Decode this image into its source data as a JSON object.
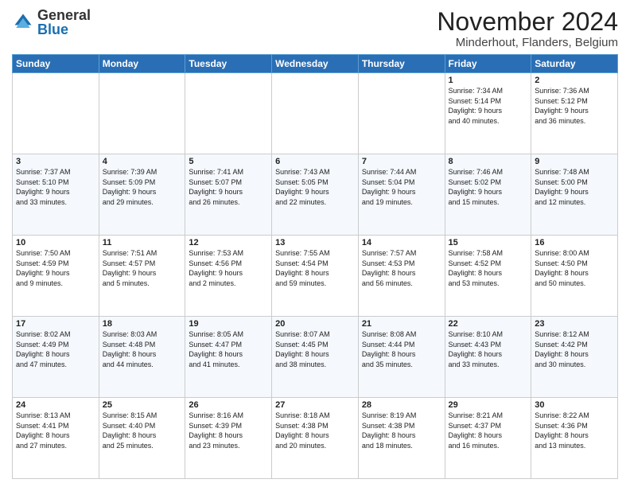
{
  "logo": {
    "general": "General",
    "blue": "Blue"
  },
  "header": {
    "month": "November 2024",
    "location": "Minderhout, Flanders, Belgium"
  },
  "weekdays": [
    "Sunday",
    "Monday",
    "Tuesday",
    "Wednesday",
    "Thursday",
    "Friday",
    "Saturday"
  ],
  "weeks": [
    [
      {
        "day": "",
        "info": ""
      },
      {
        "day": "",
        "info": ""
      },
      {
        "day": "",
        "info": ""
      },
      {
        "day": "",
        "info": ""
      },
      {
        "day": "",
        "info": ""
      },
      {
        "day": "1",
        "info": "Sunrise: 7:34 AM\nSunset: 5:14 PM\nDaylight: 9 hours\nand 40 minutes."
      },
      {
        "day": "2",
        "info": "Sunrise: 7:36 AM\nSunset: 5:12 PM\nDaylight: 9 hours\nand 36 minutes."
      }
    ],
    [
      {
        "day": "3",
        "info": "Sunrise: 7:37 AM\nSunset: 5:10 PM\nDaylight: 9 hours\nand 33 minutes."
      },
      {
        "day": "4",
        "info": "Sunrise: 7:39 AM\nSunset: 5:09 PM\nDaylight: 9 hours\nand 29 minutes."
      },
      {
        "day": "5",
        "info": "Sunrise: 7:41 AM\nSunset: 5:07 PM\nDaylight: 9 hours\nand 26 minutes."
      },
      {
        "day": "6",
        "info": "Sunrise: 7:43 AM\nSunset: 5:05 PM\nDaylight: 9 hours\nand 22 minutes."
      },
      {
        "day": "7",
        "info": "Sunrise: 7:44 AM\nSunset: 5:04 PM\nDaylight: 9 hours\nand 19 minutes."
      },
      {
        "day": "8",
        "info": "Sunrise: 7:46 AM\nSunset: 5:02 PM\nDaylight: 9 hours\nand 15 minutes."
      },
      {
        "day": "9",
        "info": "Sunrise: 7:48 AM\nSunset: 5:00 PM\nDaylight: 9 hours\nand 12 minutes."
      }
    ],
    [
      {
        "day": "10",
        "info": "Sunrise: 7:50 AM\nSunset: 4:59 PM\nDaylight: 9 hours\nand 9 minutes."
      },
      {
        "day": "11",
        "info": "Sunrise: 7:51 AM\nSunset: 4:57 PM\nDaylight: 9 hours\nand 5 minutes."
      },
      {
        "day": "12",
        "info": "Sunrise: 7:53 AM\nSunset: 4:56 PM\nDaylight: 9 hours\nand 2 minutes."
      },
      {
        "day": "13",
        "info": "Sunrise: 7:55 AM\nSunset: 4:54 PM\nDaylight: 8 hours\nand 59 minutes."
      },
      {
        "day": "14",
        "info": "Sunrise: 7:57 AM\nSunset: 4:53 PM\nDaylight: 8 hours\nand 56 minutes."
      },
      {
        "day": "15",
        "info": "Sunrise: 7:58 AM\nSunset: 4:52 PM\nDaylight: 8 hours\nand 53 minutes."
      },
      {
        "day": "16",
        "info": "Sunrise: 8:00 AM\nSunset: 4:50 PM\nDaylight: 8 hours\nand 50 minutes."
      }
    ],
    [
      {
        "day": "17",
        "info": "Sunrise: 8:02 AM\nSunset: 4:49 PM\nDaylight: 8 hours\nand 47 minutes."
      },
      {
        "day": "18",
        "info": "Sunrise: 8:03 AM\nSunset: 4:48 PM\nDaylight: 8 hours\nand 44 minutes."
      },
      {
        "day": "19",
        "info": "Sunrise: 8:05 AM\nSunset: 4:47 PM\nDaylight: 8 hours\nand 41 minutes."
      },
      {
        "day": "20",
        "info": "Sunrise: 8:07 AM\nSunset: 4:45 PM\nDaylight: 8 hours\nand 38 minutes."
      },
      {
        "day": "21",
        "info": "Sunrise: 8:08 AM\nSunset: 4:44 PM\nDaylight: 8 hours\nand 35 minutes."
      },
      {
        "day": "22",
        "info": "Sunrise: 8:10 AM\nSunset: 4:43 PM\nDaylight: 8 hours\nand 33 minutes."
      },
      {
        "day": "23",
        "info": "Sunrise: 8:12 AM\nSunset: 4:42 PM\nDaylight: 8 hours\nand 30 minutes."
      }
    ],
    [
      {
        "day": "24",
        "info": "Sunrise: 8:13 AM\nSunset: 4:41 PM\nDaylight: 8 hours\nand 27 minutes."
      },
      {
        "day": "25",
        "info": "Sunrise: 8:15 AM\nSunset: 4:40 PM\nDaylight: 8 hours\nand 25 minutes."
      },
      {
        "day": "26",
        "info": "Sunrise: 8:16 AM\nSunset: 4:39 PM\nDaylight: 8 hours\nand 23 minutes."
      },
      {
        "day": "27",
        "info": "Sunrise: 8:18 AM\nSunset: 4:38 PM\nDaylight: 8 hours\nand 20 minutes."
      },
      {
        "day": "28",
        "info": "Sunrise: 8:19 AM\nSunset: 4:38 PM\nDaylight: 8 hours\nand 18 minutes."
      },
      {
        "day": "29",
        "info": "Sunrise: 8:21 AM\nSunset: 4:37 PM\nDaylight: 8 hours\nand 16 minutes."
      },
      {
        "day": "30",
        "info": "Sunrise: 8:22 AM\nSunset: 4:36 PM\nDaylight: 8 hours\nand 13 minutes."
      }
    ]
  ]
}
